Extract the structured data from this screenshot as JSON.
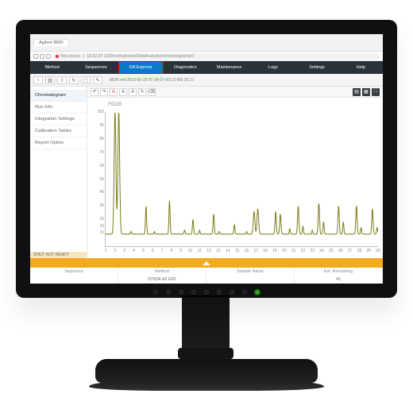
{
  "chrome": {
    "tab": "Agilent 8890",
    "url": "10.82.87.192/#complexnavDataAnalysis/chromotograms/0",
    "not_secure": "Not secure"
  },
  "nav": {
    "items": [
      "Method",
      "Sequences",
      "DA Express",
      "Diagnostics",
      "Maintenance",
      "Logs",
      "Settings",
      "Help"
    ],
    "active": 2
  },
  "toolbar": {
    "crumb": "MON red 2019-05-18 07-25-07-001 D MS SC D"
  },
  "toolbar_icons": [
    "chevron-left",
    "doc",
    "doc-arrow",
    "refresh",
    "square",
    "page"
  ],
  "sidebar": {
    "items": [
      "Chromatogram",
      "Run Info",
      "Integration Settings",
      "Calibration Tables",
      "Report Option"
    ],
    "active": 0
  },
  "ctool": {
    "left": [
      "undo",
      "redo",
      "A-red",
      "A",
      "A",
      "pencil",
      "erase"
    ],
    "right": [
      "layers",
      "grid",
      "fullscreen"
    ]
  },
  "footer": {
    "warnLabel": "SHUT: NOT READY",
    "labels": [
      "Method",
      "Sample Name",
      "Est. Remaining"
    ],
    "values": [
      "075DA HZ H20",
      "",
      "41"
    ],
    "sequence_label": "Sequence"
  },
  "chart_data": {
    "type": "line",
    "title": "FID1B",
    "ylabel": "",
    "xlabel": "",
    "ylim": [
      0,
      100
    ],
    "yticks": [
      10,
      15,
      20,
      30,
      40,
      50,
      60,
      70,
      80,
      90,
      100
    ],
    "xlim": [
      1,
      30
    ],
    "xticks": [
      1,
      2,
      3,
      4,
      5,
      6,
      7,
      8,
      9,
      10,
      11,
      12,
      13,
      14,
      15,
      16,
      17,
      18,
      19,
      20,
      21,
      22,
      23,
      24,
      25,
      26,
      27,
      28,
      29,
      30
    ],
    "baseline": 9,
    "peaks": [
      {
        "x": 2.0,
        "h": 100,
        "w": 0.22
      },
      {
        "x": 2.4,
        "h": 100,
        "w": 0.22
      },
      {
        "x": 3.7,
        "h": 11,
        "w": 0.12
      },
      {
        "x": 5.3,
        "h": 30,
        "w": 0.14
      },
      {
        "x": 6.2,
        "h": 11,
        "w": 0.12
      },
      {
        "x": 7.8,
        "h": 34,
        "w": 0.14
      },
      {
        "x": 9.4,
        "h": 12,
        "w": 0.13
      },
      {
        "x": 10.3,
        "h": 20,
        "w": 0.14
      },
      {
        "x": 11.0,
        "h": 12,
        "w": 0.12
      },
      {
        "x": 12.5,
        "h": 24,
        "w": 0.14
      },
      {
        "x": 13.1,
        "h": 11,
        "w": 0.12
      },
      {
        "x": 14.7,
        "h": 16,
        "w": 0.13
      },
      {
        "x": 16.0,
        "h": 11,
        "w": 0.12
      },
      {
        "x": 16.8,
        "h": 26,
        "w": 0.2
      },
      {
        "x": 17.2,
        "h": 28,
        "w": 0.2
      },
      {
        "x": 19.1,
        "h": 26,
        "w": 0.15
      },
      {
        "x": 19.6,
        "h": 24,
        "w": 0.15
      },
      {
        "x": 20.6,
        "h": 13,
        "w": 0.13
      },
      {
        "x": 21.5,
        "h": 30,
        "w": 0.16
      },
      {
        "x": 22.0,
        "h": 15,
        "w": 0.13
      },
      {
        "x": 23.0,
        "h": 12,
        "w": 0.12
      },
      {
        "x": 23.7,
        "h": 32,
        "w": 0.16
      },
      {
        "x": 24.2,
        "h": 18,
        "w": 0.14
      },
      {
        "x": 25.8,
        "h": 30,
        "w": 0.16
      },
      {
        "x": 26.3,
        "h": 18,
        "w": 0.14
      },
      {
        "x": 27.7,
        "h": 30,
        "w": 0.16
      },
      {
        "x": 28.2,
        "h": 14,
        "w": 0.13
      },
      {
        "x": 29.4,
        "h": 28,
        "w": 0.16
      },
      {
        "x": 29.9,
        "h": 14,
        "w": 0.13
      }
    ]
  }
}
